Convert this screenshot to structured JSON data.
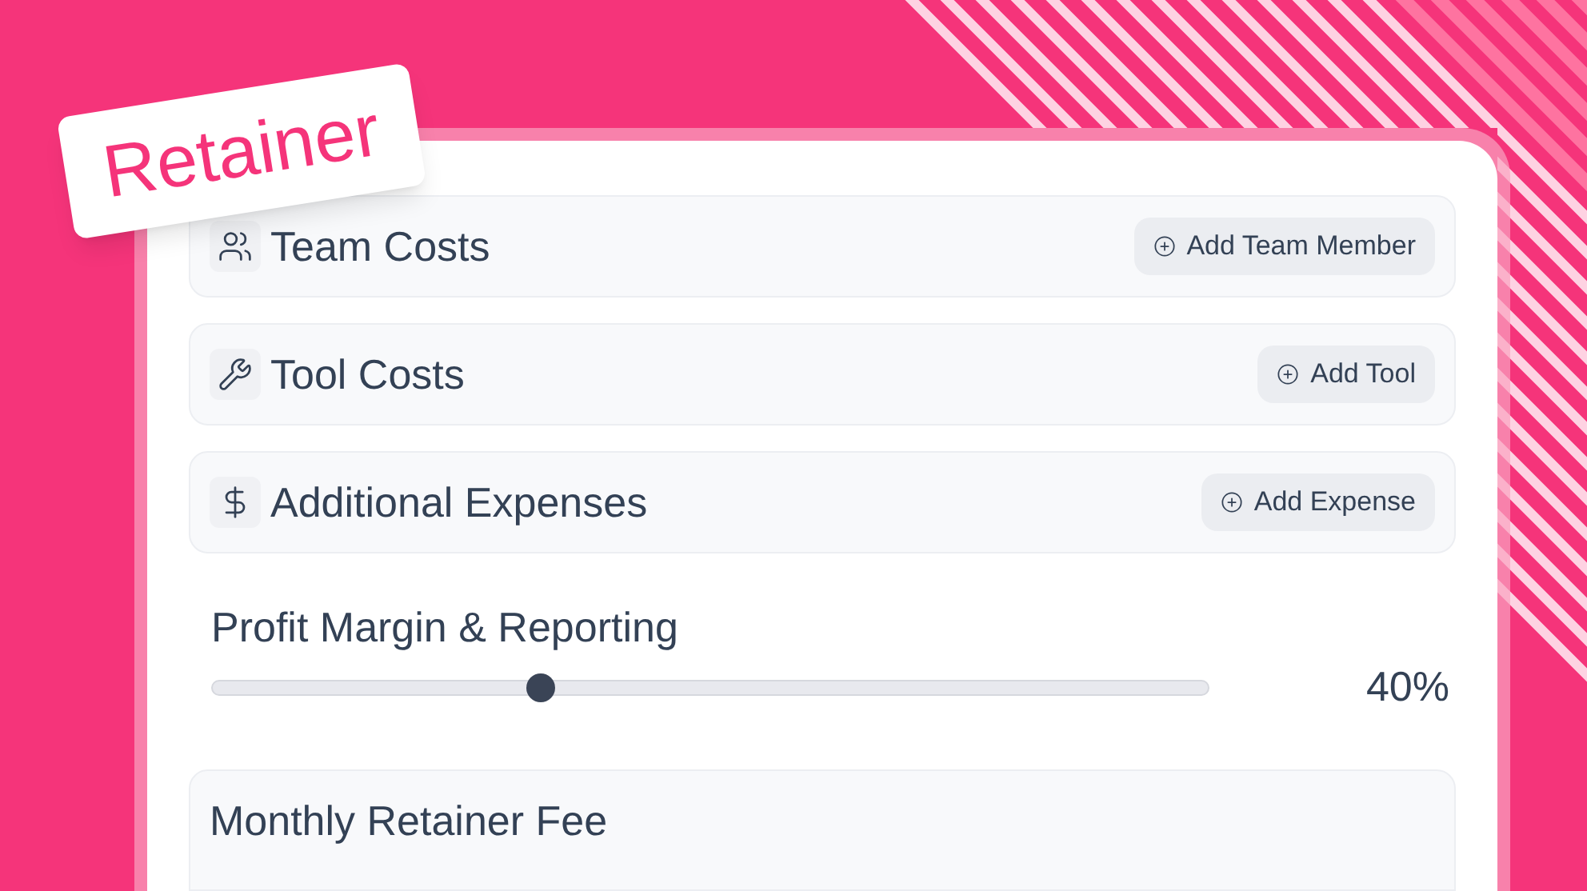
{
  "badge": {
    "label": "Retainer"
  },
  "sections": [
    {
      "title": "Team Costs",
      "action": "Add Team Member"
    },
    {
      "title": "Tool Costs",
      "action": "Add Tool"
    },
    {
      "title": "Additional Expenses",
      "action": "Add Expense"
    }
  ],
  "profit": {
    "title": "Profit Margin & Reporting",
    "level": 0.33,
    "reading": "40%"
  },
  "fee": {
    "title": "Monthly Retainer Fee"
  }
}
